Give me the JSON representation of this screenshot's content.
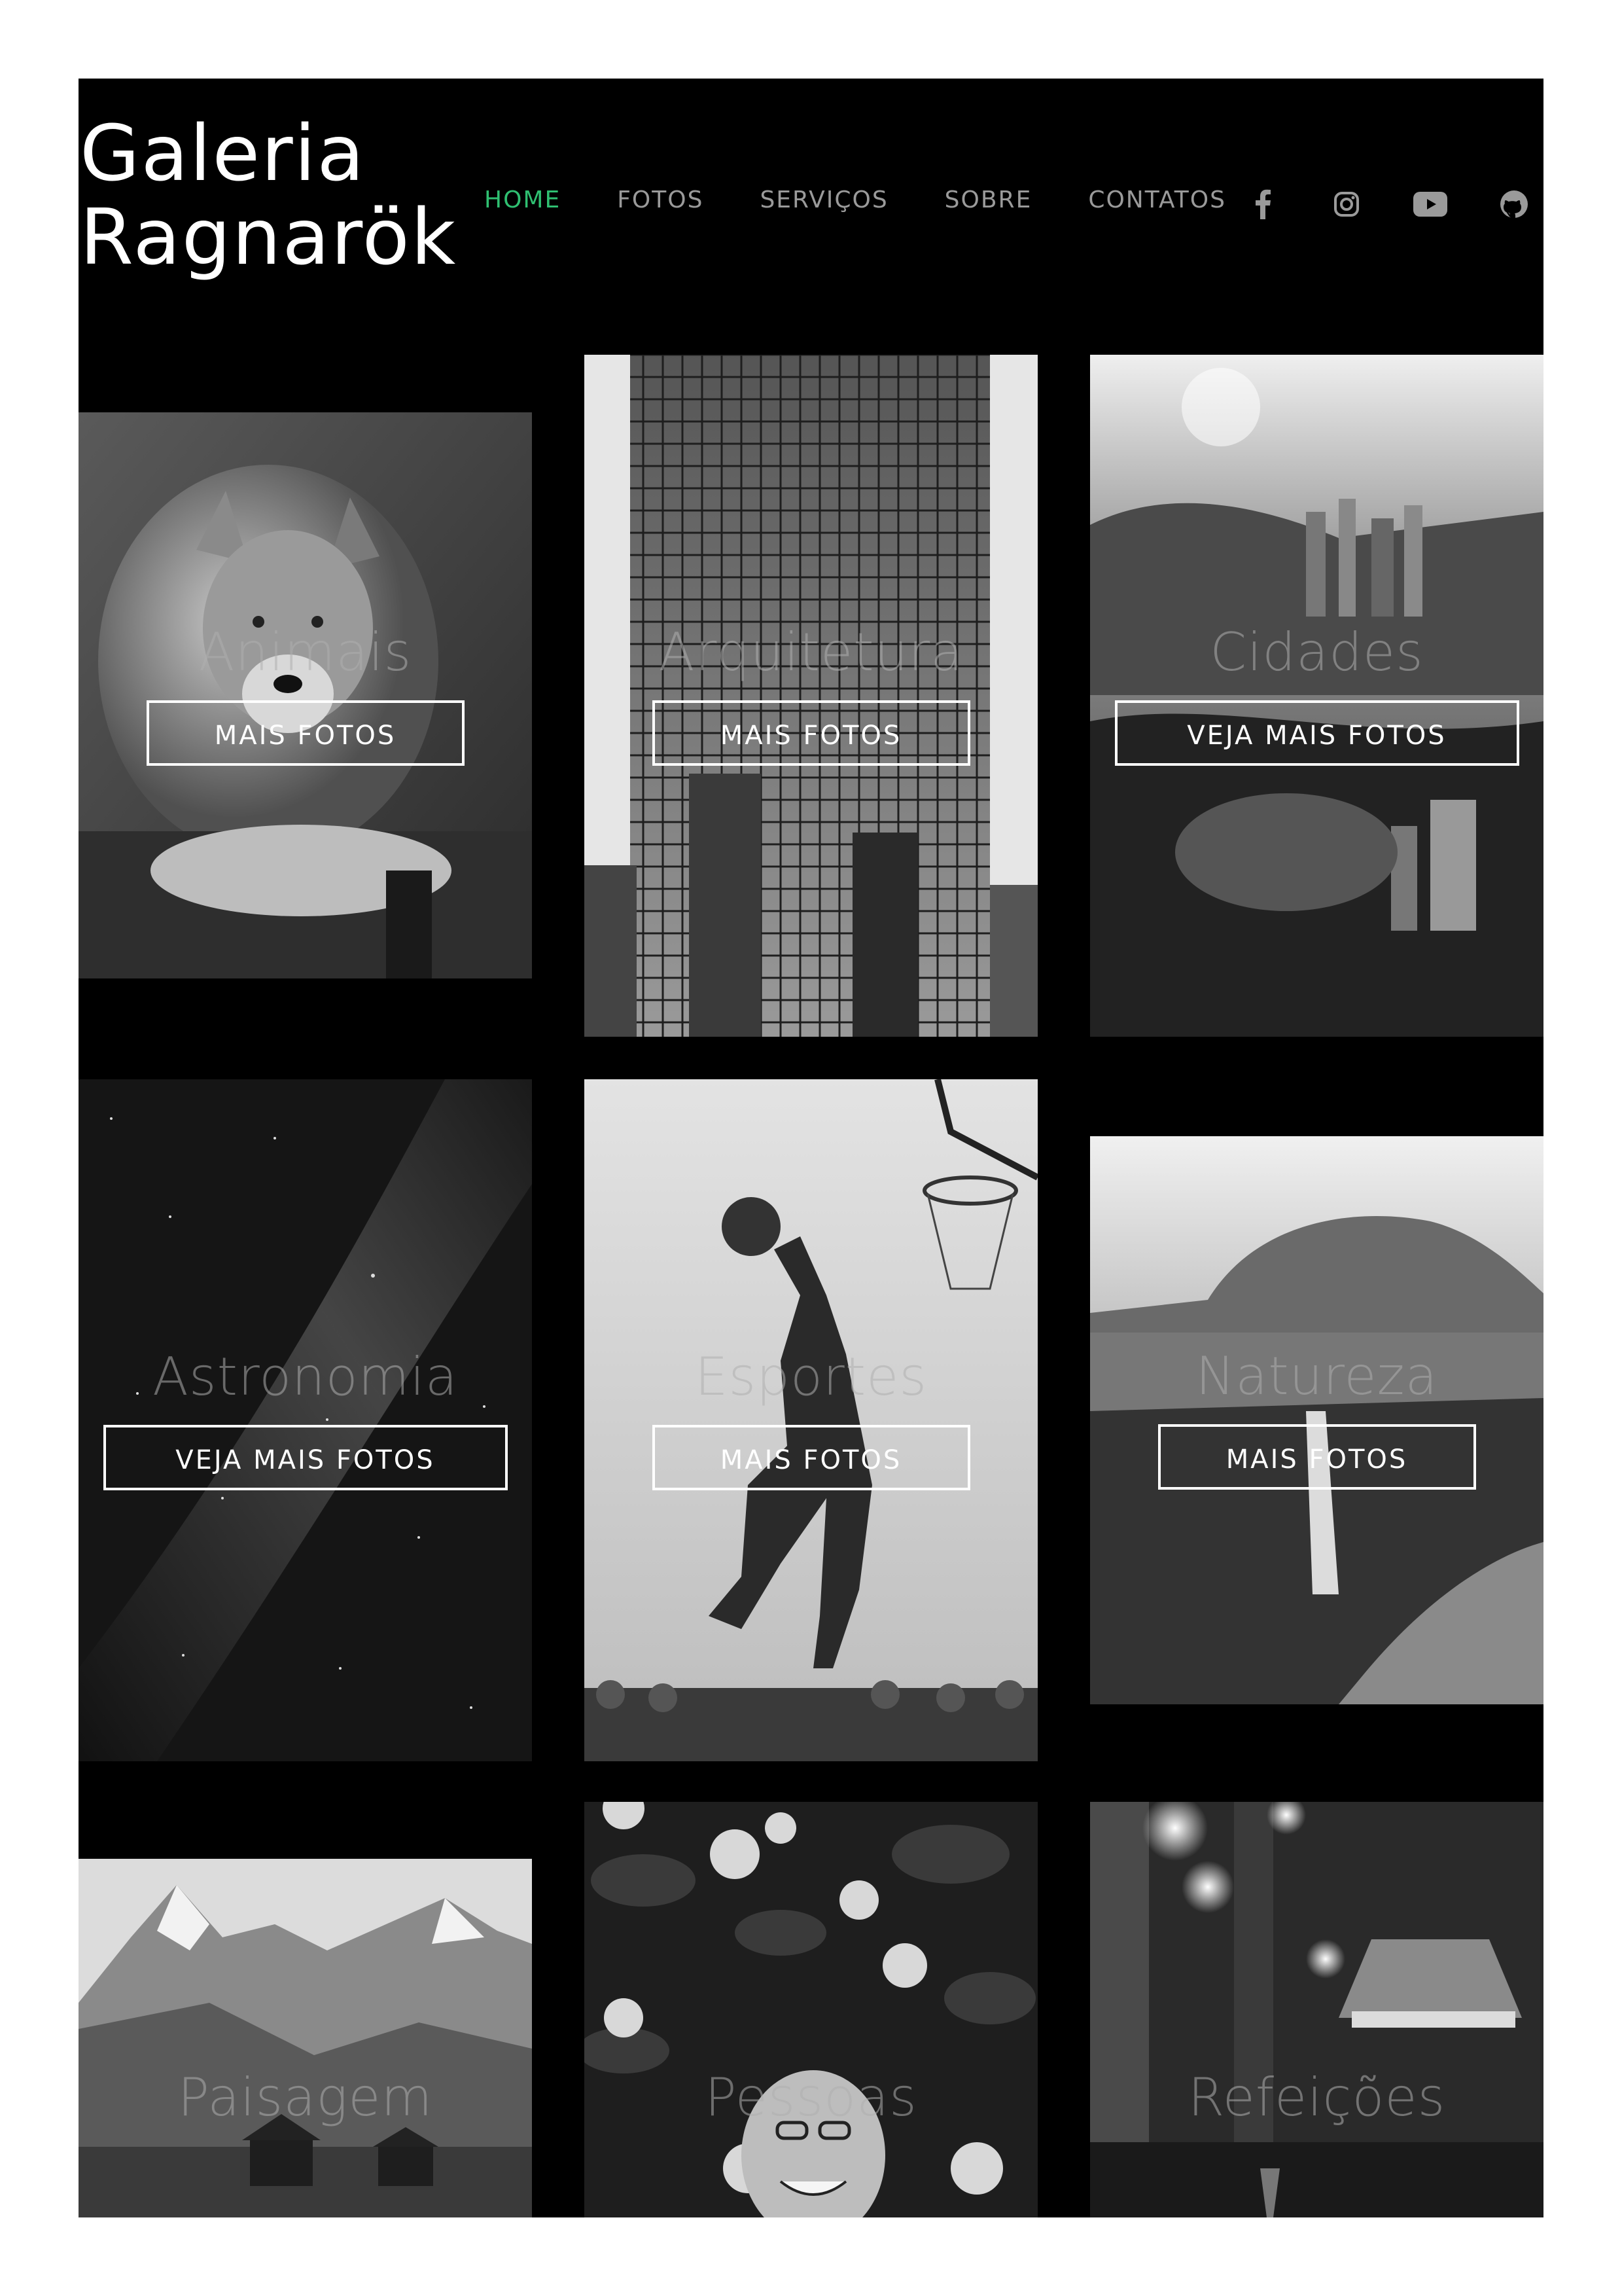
{
  "brand": {
    "line1": "Galeria",
    "line2": "Ragnarök"
  },
  "nav": {
    "items": [
      {
        "label": "HOME",
        "active": true
      },
      {
        "label": "FOTOS",
        "active": false
      },
      {
        "label": "SERVIÇOS",
        "active": false
      },
      {
        "label": "SOBRE",
        "active": false
      },
      {
        "label": "CONTATOS",
        "active": false
      }
    ],
    "active_color": "#2fbf71",
    "inactive_color": "#9a9a9a"
  },
  "social": [
    "facebook-icon",
    "instagram-icon",
    "youtube-icon",
    "github-icon"
  ],
  "gallery": [
    {
      "title": "Animais",
      "button": "MAIS FOTOS"
    },
    {
      "title": "Arquitetura",
      "button": "MAIS FOTOS"
    },
    {
      "title": "Cidades",
      "button": "VEJA MAIS FOTOS"
    },
    {
      "title": "Astronomia",
      "button": "VEJA MAIS FOTOS"
    },
    {
      "title": "Esportes",
      "button": "MAIS FOTOS"
    },
    {
      "title": "Natureza",
      "button": "MAIS FOTOS"
    },
    {
      "title": "Paisagem",
      "button": ""
    },
    {
      "title": "Pessoas",
      "button": ""
    },
    {
      "title": "Refeições",
      "button": ""
    }
  ]
}
